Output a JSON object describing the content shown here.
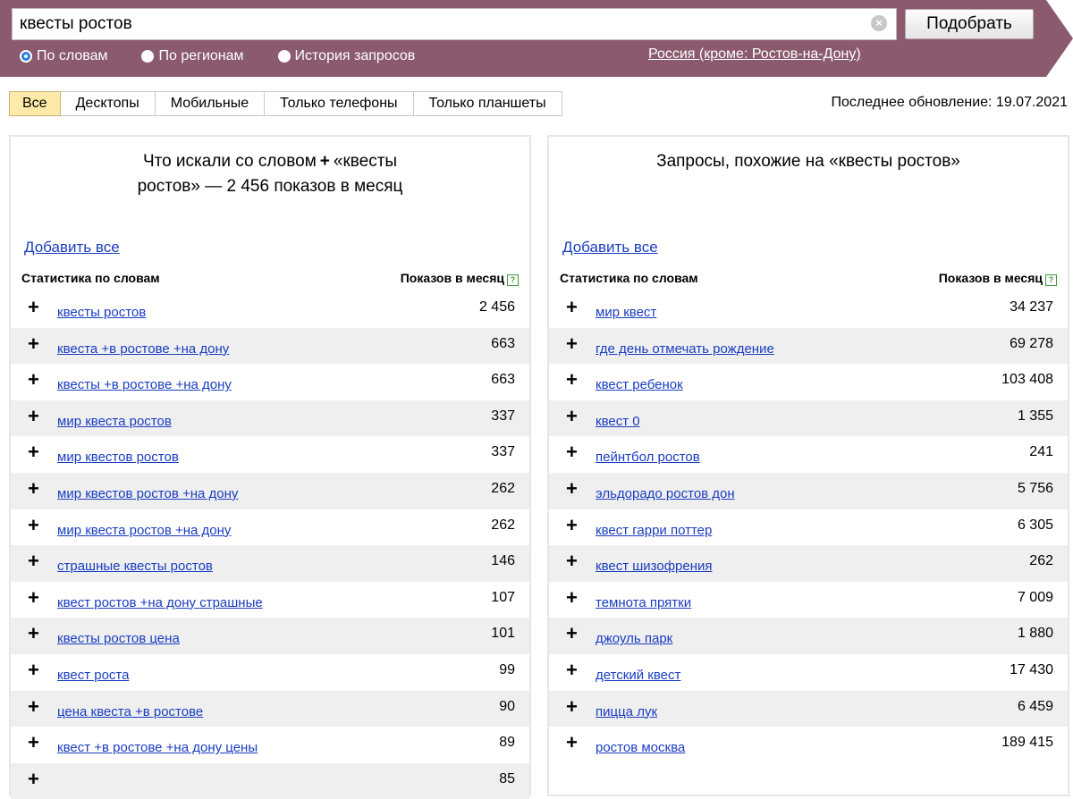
{
  "search": {
    "value": "квесты ростов",
    "submit_label": "Подобрать",
    "options": [
      {
        "label": "По словам",
        "checked": true
      },
      {
        "label": "По регионам",
        "checked": false
      },
      {
        "label": "История запросов",
        "checked": false
      }
    ],
    "region": "Россия (кроме: Ростов-на-Дону)"
  },
  "tabs": [
    {
      "label": "Все",
      "active": true
    },
    {
      "label": "Десктопы",
      "active": false
    },
    {
      "label": "Мобильные",
      "active": false
    },
    {
      "label": "Только телефоны",
      "active": false
    },
    {
      "label": "Только планшеты",
      "active": false
    }
  ],
  "last_update": "Последнее обновление: 19.07.2021",
  "colors": {
    "header_band": "#8b5a6e",
    "link": "#1a3dc1",
    "active_tab": "#fdeaa8"
  },
  "left_panel": {
    "title_line1": "Что искали со словом",
    "title_quote1": "«квесты",
    "title_line2": "ростов» — 2 456 показов в месяц",
    "add_all": "Добавить все",
    "col_left": "Статистика по словам",
    "col_right": "Показов в месяц",
    "rows": [
      {
        "phrase": "квесты ростов",
        "count": "2 456"
      },
      {
        "phrase": "квеста +в ростове +на дону",
        "count": "663"
      },
      {
        "phrase": "квесты +в ростове +на дону",
        "count": "663"
      },
      {
        "phrase": "мир квеста ростов",
        "count": "337"
      },
      {
        "phrase": "мир квестов ростов",
        "count": "337"
      },
      {
        "phrase": "мир квестов ростов +на дону",
        "count": "262"
      },
      {
        "phrase": "мир квеста ростов +на дону",
        "count": "262"
      },
      {
        "phrase": "страшные квесты ростов",
        "count": "146"
      },
      {
        "phrase": "квест ростов +на дону страшные",
        "count": "107"
      },
      {
        "phrase": "квесты ростов цена",
        "count": "101"
      },
      {
        "phrase": "квест роста",
        "count": "99"
      },
      {
        "phrase": "цена квеста +в ростове",
        "count": "90"
      },
      {
        "phrase": "квест +в ростове +на дону цены",
        "count": "89"
      },
      {
        "phrase": "",
        "count": "85"
      }
    ]
  },
  "right_panel": {
    "title": "Запросы, похожие на «квесты ростов»",
    "add_all": "Добавить все",
    "col_left": "Статистика по словам",
    "col_right": "Показов в месяц",
    "rows": [
      {
        "phrase": "мир квест",
        "count": "34 237"
      },
      {
        "phrase": "где день отмечать рождение",
        "count": "69 278"
      },
      {
        "phrase": "квест ребенок",
        "count": "103 408"
      },
      {
        "phrase": "квест 0",
        "count": "1 355"
      },
      {
        "phrase": "пейнтбол ростов",
        "count": "241"
      },
      {
        "phrase": "эльдорадо ростов дон",
        "count": "5 756"
      },
      {
        "phrase": "квест гарри поттер",
        "count": "6 305"
      },
      {
        "phrase": "квест шизофрения",
        "count": "262"
      },
      {
        "phrase": "темнота прятки",
        "count": "7 009"
      },
      {
        "phrase": "джоуль парк",
        "count": "1 880"
      },
      {
        "phrase": "детский квест",
        "count": "17 430"
      },
      {
        "phrase": "пицца лук",
        "count": "6 459"
      },
      {
        "phrase": "ростов москва",
        "count": "189 415"
      }
    ]
  }
}
